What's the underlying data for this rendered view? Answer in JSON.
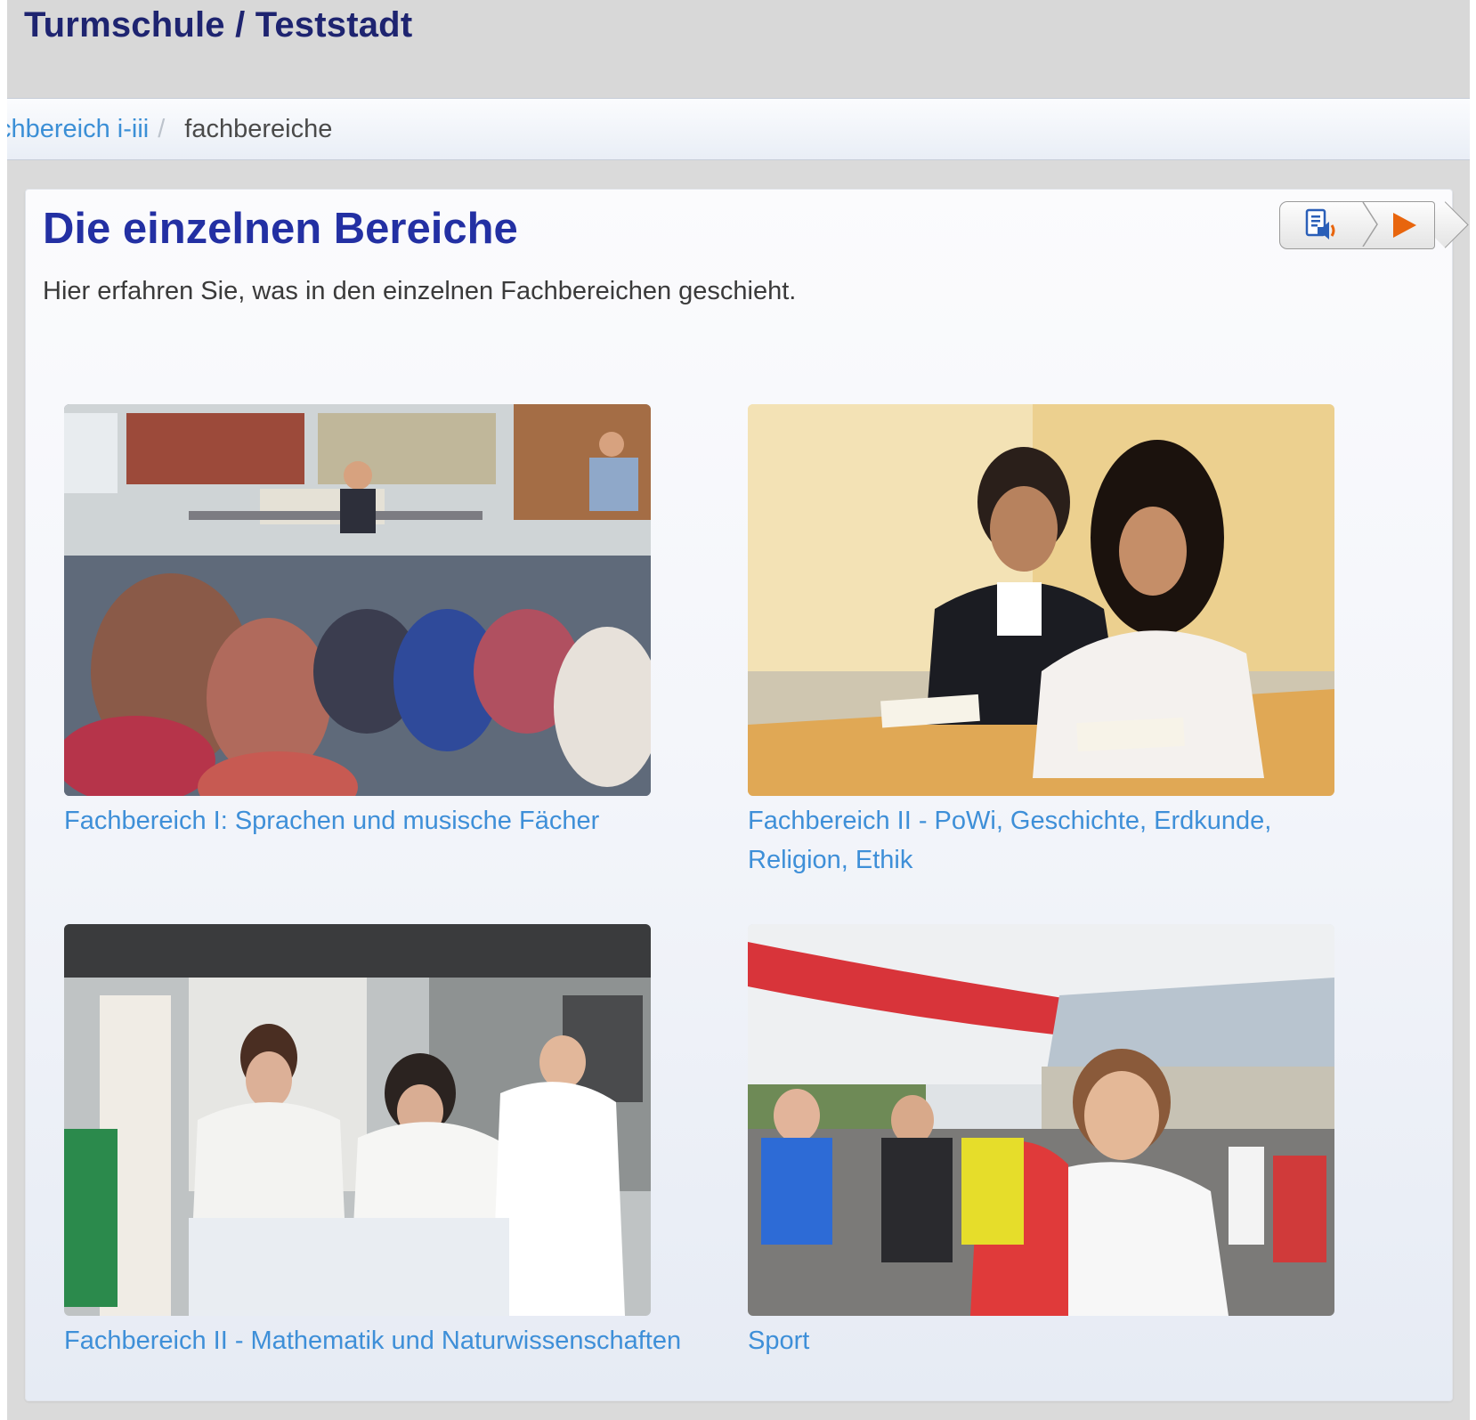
{
  "header": {
    "site_title": "Turmschule / Teststadt"
  },
  "breadcrumb": {
    "parent_label": "chbereich i-iii",
    "separator": "/",
    "current_label": "fachbereiche"
  },
  "main": {
    "title": "Die einzelnen Bereiche",
    "intro": "Hier erfahren Sie, was in den einzelnen Fachbereichen geschieht.",
    "readspeaker": {
      "listen_icon": "speaker-document-icon",
      "play_icon": "play-icon",
      "accent_color": "#e8650d"
    },
    "tiles": [
      {
        "caption": "Fachbereich I: Sprachen und musische Fächer",
        "image": "students-reading-in-library-photo"
      },
      {
        "caption": "Fachbereich II - PoWi, Geschichte, Erdkunde, Religion, Ethik",
        "image": "students-debate-at-desk-photo"
      },
      {
        "caption": "Fachbereich II - Mathematik und Naturwissenschaften",
        "image": "students-in-lab-coats-photo"
      },
      {
        "caption": "Sport",
        "image": "school-run-start-line-photo"
      }
    ]
  },
  "colors": {
    "title_blue": "#2330a3",
    "header_title": "#1e2470",
    "link_blue": "#3e8fd8"
  }
}
